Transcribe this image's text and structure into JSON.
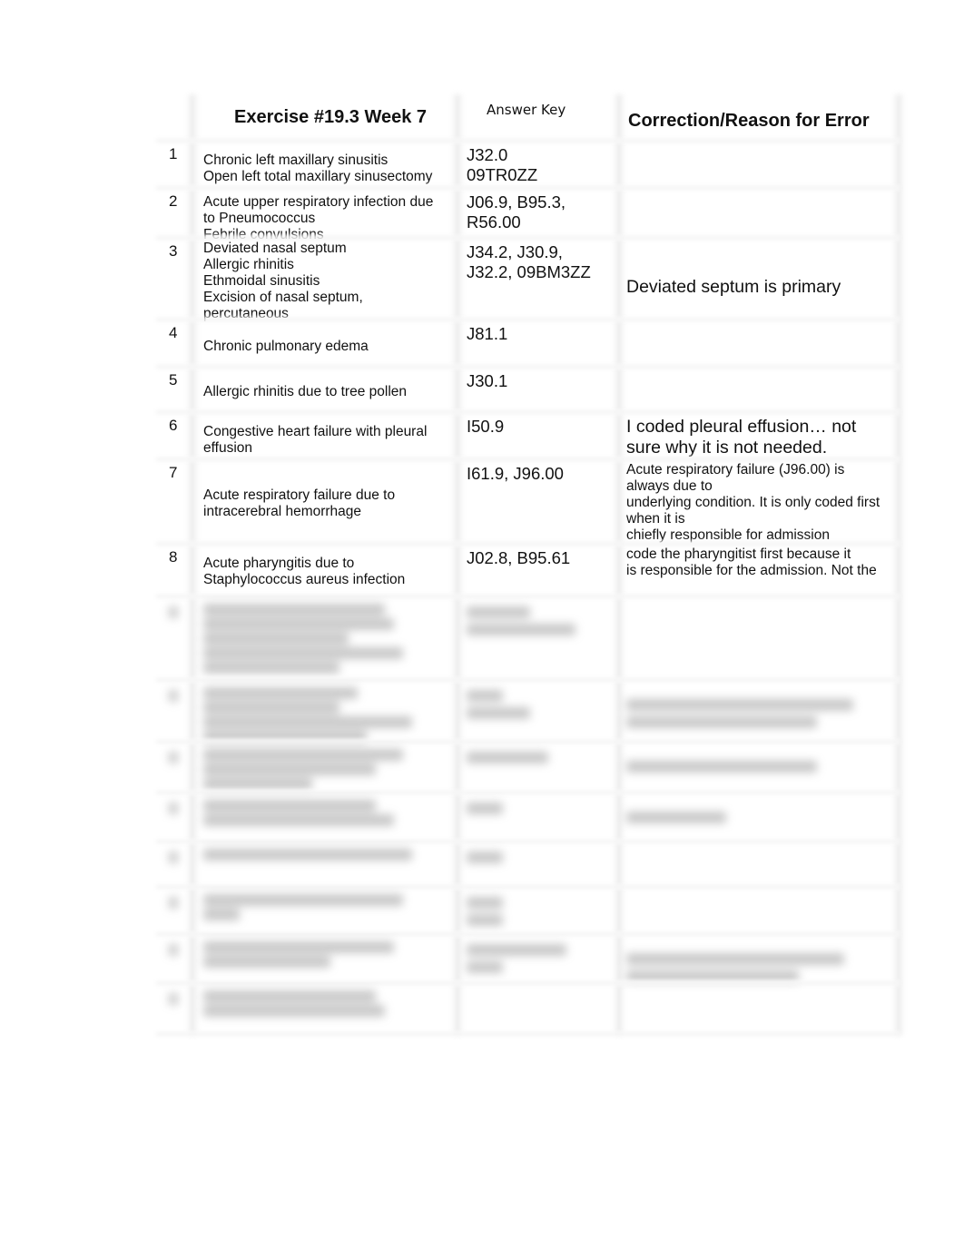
{
  "header": {
    "col_number": "",
    "col_exercise": "Exercise #19.3 Week 7",
    "col_answer_key": "Answer Key",
    "col_correction": "Correction/Reason for Error"
  },
  "rows": [
    {
      "number": "1",
      "diagnosis": [
        "Chronic left maxillary sinusitis",
        "Open left total maxillary sinusectomy"
      ],
      "codes": [
        "J32.0",
        "09TR0ZZ"
      ],
      "correction": [],
      "correction_size": "large"
    },
    {
      "number": "2",
      "diagnosis": [
        "Acute upper respiratory infection due",
        "to Pneumococcus",
        "Febrile convulsions"
      ],
      "codes": [
        "J06.9, B95.3,",
        "R56.00"
      ],
      "correction": [],
      "correction_size": "large"
    },
    {
      "number": "3",
      "diagnosis": [
        "Deviated nasal septum",
        "Allergic rhinitis",
        "Ethmoidal sinusitis",
        "Excision of nasal septum,",
        "percutaneous"
      ],
      "codes": [
        "J34.2, J30.9,",
        "J32.2, 09BM3ZZ"
      ],
      "correction": [
        "Deviated septum is primary"
      ],
      "correction_size": "large"
    },
    {
      "number": "4",
      "diagnosis": [
        "Chronic pulmonary edema"
      ],
      "codes": [
        "J81.1"
      ],
      "correction": [],
      "correction_size": "large"
    },
    {
      "number": "5",
      "diagnosis": [
        "Allergic rhinitis due to tree pollen"
      ],
      "codes": [
        "J30.1"
      ],
      "correction": [],
      "correction_size": "large"
    },
    {
      "number": "6",
      "diagnosis": [
        "Congestive heart failure with pleural",
        "effusion"
      ],
      "codes": [
        "I50.9"
      ],
      "correction": [
        "I coded pleural effusion… not",
        "sure why it is not needed."
      ],
      "correction_size": "large"
    },
    {
      "number": "7",
      "diagnosis": [
        "Acute respiratory failure due to",
        "intracerebral hemorrhage"
      ],
      "codes": [
        "I61.9, J96.00"
      ],
      "correction": [
        "Acute respiratory failure (J96.00) is",
        "always due to",
        "underlying condition. It is only coded first",
        "when it is",
        "chiefly responsible for admission"
      ],
      "correction_size": "small"
    },
    {
      "number": "8",
      "diagnosis": [
        "Acute pharyngitis due to",
        "Staphylococcus aureus infection"
      ],
      "codes": [
        "J02.8, B95.61"
      ],
      "correction": [
        "code the pharyngitist first because it",
        "is responsible for the admission. Not the"
      ],
      "correction_size": "small"
    }
  ],
  "blurred_rows_count": 8
}
